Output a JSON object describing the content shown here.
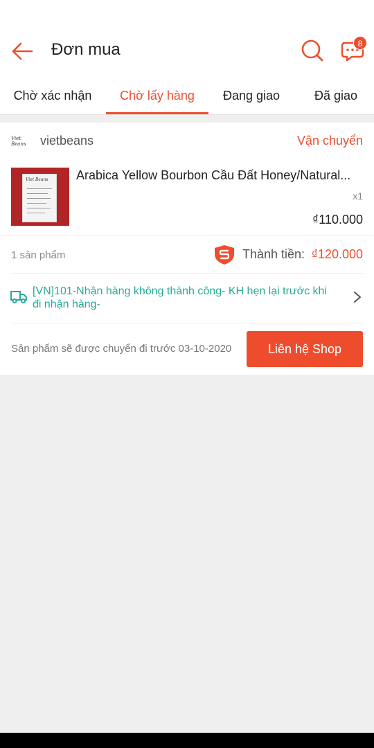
{
  "header": {
    "title": "Đơn mua",
    "chat_badge": "8"
  },
  "tabs": [
    {
      "label": "Chờ xác nhận",
      "active": false
    },
    {
      "label": "Chờ lấy hàng",
      "active": true
    },
    {
      "label": "Đang giao",
      "active": false
    },
    {
      "label": "Đã giao",
      "active": false
    }
  ],
  "order": {
    "shop_logo_text": "Viet Beans",
    "shop_name": "vietbeans",
    "shipping_status": "Vận chuyển",
    "product": {
      "name": "Arabica Yellow Bourbon Cầu Đất Honey/Natural...",
      "quantity": "x1",
      "price": "₫110.000",
      "image_label": "Viet Beans"
    },
    "item_count": "1 sản phẩm",
    "total_label": "Thành tiền:",
    "total_value": "₫120.000",
    "tracking": "[VN]101-Nhận hàng không thành công- KH hẹn lại trước khi đi nhận hàng-",
    "ship_note": "Sản phẩm sẽ được chuyển đi trước 03-10-2020",
    "contact_button": "Liên hệ Shop"
  },
  "colors": {
    "accent": "#ee4d2d",
    "tracking": "#26aa99"
  },
  "icons": [
    "back-arrow-icon",
    "search-icon",
    "chat-icon",
    "shield-icon",
    "truck-icon",
    "chevron-right-icon"
  ]
}
